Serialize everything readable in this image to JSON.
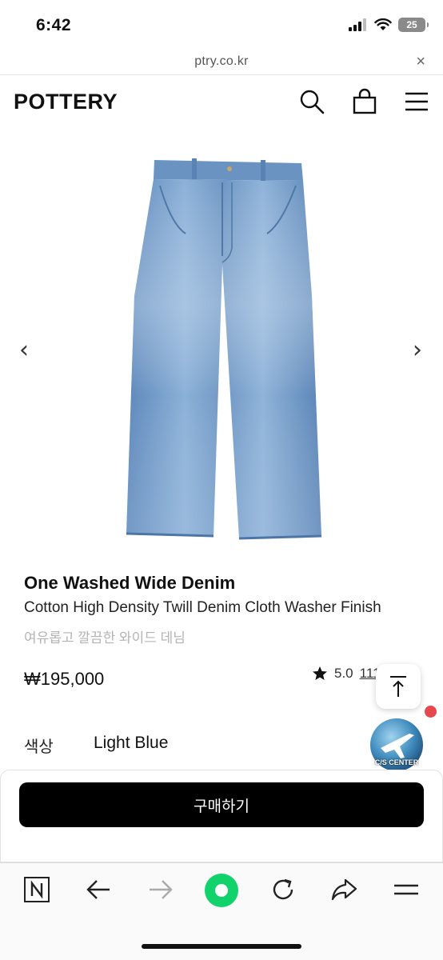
{
  "status_bar": {
    "time": "6:42",
    "battery": "25"
  },
  "browser": {
    "url": "ptry.co.kr",
    "close_icon": "×"
  },
  "site": {
    "logo": "POTTERY",
    "icons": [
      "search-icon",
      "shopping-bag-icon",
      "menu-icon"
    ]
  },
  "gallery": {
    "prev_arrow": "‹",
    "next_arrow": "›",
    "image": "light-blue-wide-denim-jeans"
  },
  "product": {
    "name": "One Washed Wide Denim",
    "subtitle": "Cotton High Density Twill Denim Cloth Washer Finish",
    "description_ko": "여유롭고 깔끔한 와이드 데님",
    "price": "₩195,000",
    "rating": "5.0",
    "review_count": "111"
  },
  "options": {
    "color_label": "색상",
    "color_value": "Light Blue"
  },
  "cs_center": {
    "label": "C/S CENTER"
  },
  "buy": {
    "label": "구매하기"
  },
  "toolbar": {
    "icons": [
      "naver-icon",
      "back-arrow-icon",
      "forward-arrow-icon",
      "green-dot-icon",
      "refresh-icon",
      "share-icon",
      "menu-lines-icon"
    ]
  },
  "colors": {
    "accent_green": "#12d36b",
    "badge_red": "#e5484d",
    "denim_blue": "#6f97c4"
  }
}
